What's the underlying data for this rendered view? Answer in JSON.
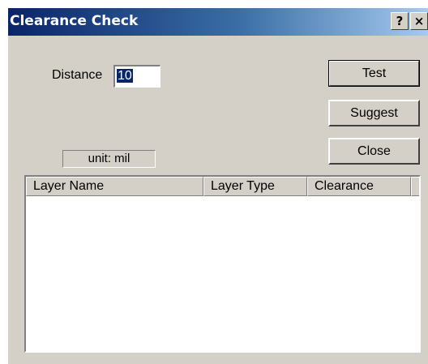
{
  "window": {
    "title": "Clearance Check",
    "help_glyph": "?",
    "close_glyph": "×"
  },
  "form": {
    "distance_label": "Distance",
    "distance_value": "10",
    "unit_text": "unit: mil"
  },
  "buttons": {
    "test": "Test",
    "suggest": "Suggest",
    "close": "Close"
  },
  "table": {
    "columns": [
      "Layer Name",
      "Layer Type",
      "Clearance"
    ],
    "rows": []
  }
}
